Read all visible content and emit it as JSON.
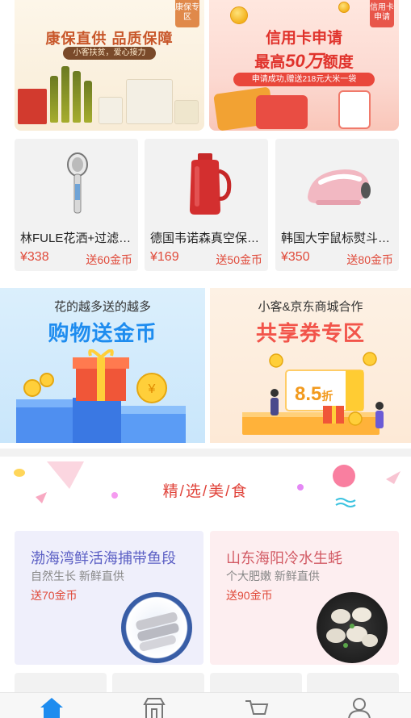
{
  "banners": {
    "left": {
      "corner_tag": "康保专区",
      "title": "康保直供 品质保障",
      "subtitle": "小客扶贫，爱心接力"
    },
    "right": {
      "corner_tag": "信用卡申请",
      "title": "信用卡申请",
      "amount_prefix": "最高",
      "amount": "50万",
      "amount_suffix": "额度",
      "subtitle": "申请成功,赠送218元大米一袋"
    }
  },
  "products": [
    {
      "name": "林FULE花洒+过滤…",
      "price": "¥338",
      "coins": "送60金币",
      "icon": "shower-head-icon"
    },
    {
      "name": "德国韦诺森真空保…",
      "price": "¥169",
      "coins": "送50金币",
      "icon": "vacuum-flask-icon"
    },
    {
      "name": "韩国大宇鼠标熨斗…",
      "price": "¥350",
      "coins": "送80金币",
      "icon": "steam-iron-icon"
    }
  ],
  "promos": {
    "left": {
      "tag": "花的越多送的越多",
      "headline": "购物送金币"
    },
    "right": {
      "tag": "小客&京东商城合作",
      "headline": "共享券专区",
      "discount": "8.5",
      "discount_unit": "折"
    }
  },
  "food_section": {
    "title": "精/选/美/食",
    "cards": [
      {
        "name": "渤海湾鲜活海捕带鱼段",
        "desc": "自然生长 新鲜直供",
        "coins": "送70金币",
        "icon": "fish-plate-icon"
      },
      {
        "name": "山东海阳冷水生蚝",
        "desc": "个大肥嫩 新鲜直供",
        "coins": "送90金币",
        "icon": "oyster-plate-icon"
      }
    ]
  },
  "bottom_nav": [
    {
      "icon": "home-icon",
      "active": true
    },
    {
      "icon": "shop-icon",
      "active": false
    },
    {
      "icon": "cart-icon",
      "active": false
    },
    {
      "icon": "user-icon",
      "active": false
    }
  ],
  "colors": {
    "accent_red": "#e04a3a",
    "nav_active": "#1e8cef",
    "promo_blue": "#1e8cef",
    "promo_red": "#f2544a"
  }
}
